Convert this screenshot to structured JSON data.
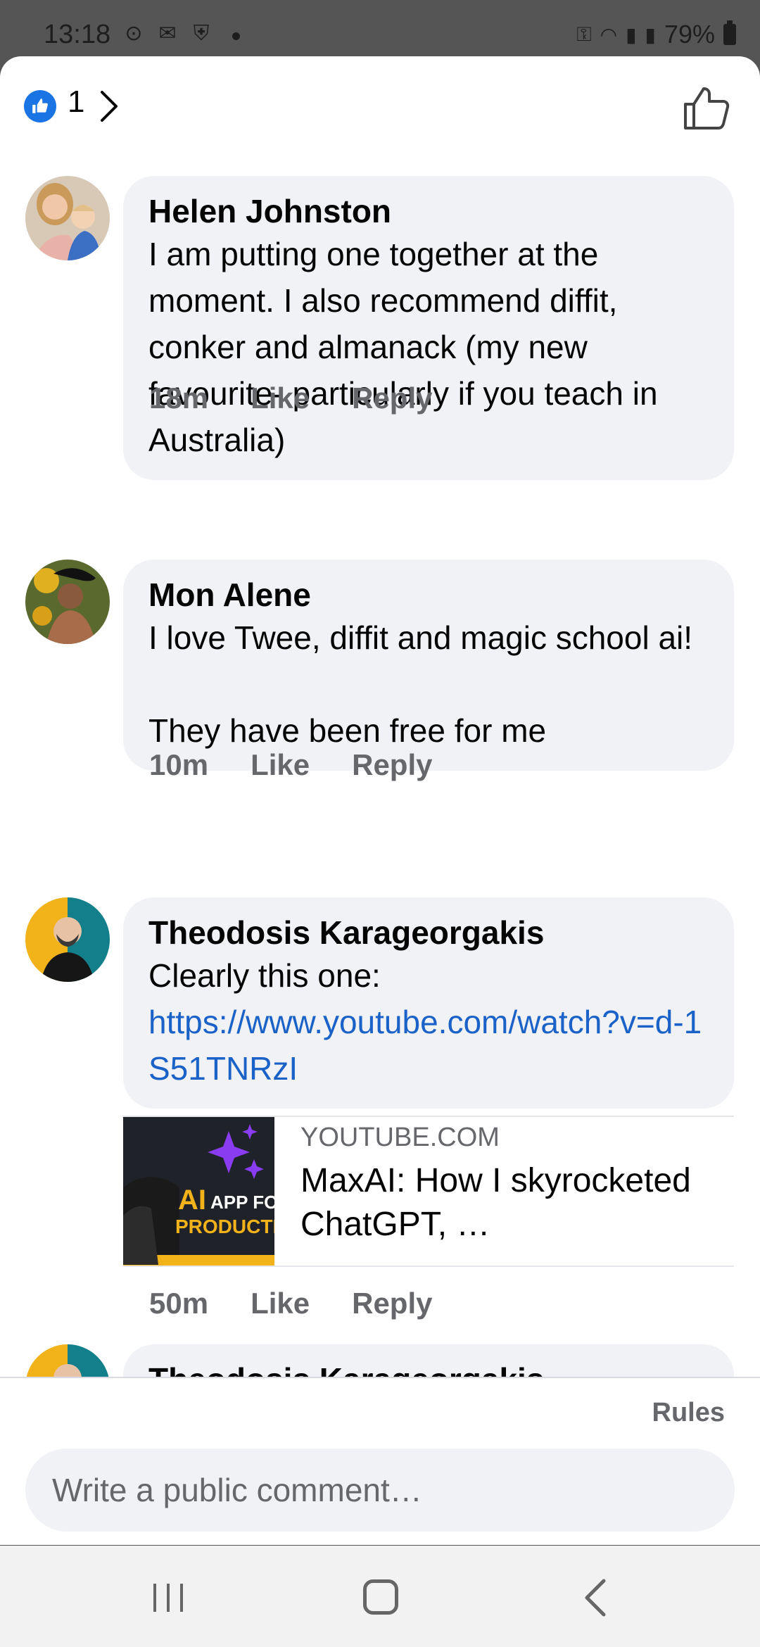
{
  "status_bar": {
    "time": "13:18",
    "battery": "79%"
  },
  "header": {
    "like_count": "1"
  },
  "comments": [
    {
      "author": "Helen Johnston",
      "text": "I am putting one together at the moment. I also recommend diffit, conker and almanack (my new favourite- particularly if you teach in Australia)",
      "time": "18m",
      "like_label": "Like",
      "reply_label": "Reply"
    },
    {
      "author": "Mon Alene",
      "text": "I love Twee, diffit and magic school ai!\n\nThey have been free for me",
      "time": "10m",
      "like_label": "Like",
      "reply_label": "Reply"
    },
    {
      "author": "Theodosis Karageorgakis",
      "text": "Clearly this one:",
      "link": "https://www.youtube.com/watch?v=d-1S51TNRzI",
      "preview": {
        "domain": "YOUTUBE.COM",
        "title": "MaxAI: How I skyrocketed ChatGPT, …",
        "thumb_text_1": "AI",
        "thumb_text_2": "APP FO",
        "thumb_text_3": "PRODUCTI"
      },
      "time": "50m",
      "like_label": "Like",
      "reply_label": "Reply"
    },
    {
      "author": "Theodosis Karageorgakis"
    }
  ],
  "footer": {
    "rules_label": "Rules",
    "input_placeholder": "Write a public comment…"
  },
  "colors": {
    "accent": "#1b74e4",
    "link": "#1a62c8",
    "bubble": "#f0f2f5",
    "secondary_text": "#65676b"
  }
}
